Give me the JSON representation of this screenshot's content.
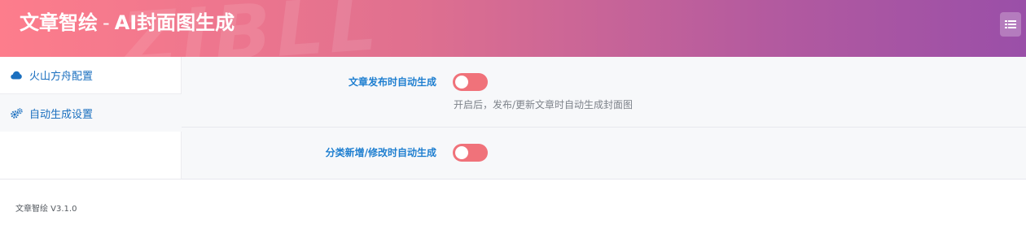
{
  "header": {
    "title_main": "文章智绘",
    "title_sep": "-",
    "title_sub": "AI封面图生成",
    "watermark": "ZIBLL",
    "menu_icon": "menu-list-icon"
  },
  "sidebar": {
    "items": [
      {
        "label": "火山方舟配置",
        "icon": "cloud-icon",
        "active": false
      },
      {
        "label": "自动生成设置",
        "icon": "gears-icon",
        "active": true
      }
    ]
  },
  "settings": [
    {
      "label": "文章发布时自动生成",
      "enabled": false,
      "description": "开启后，发布/更新文章时自动生成封面图"
    },
    {
      "label": "分类新增/修改时自动生成",
      "enabled": false
    }
  ],
  "colors": {
    "accent_blue": "#1f7fd0",
    "toggle_color": "#f0727a",
    "header_gradient_start": "#fd7d8c",
    "header_gradient_end": "#9a4fa8"
  },
  "footer": {
    "version": "文章智绘 V3.1.0"
  }
}
